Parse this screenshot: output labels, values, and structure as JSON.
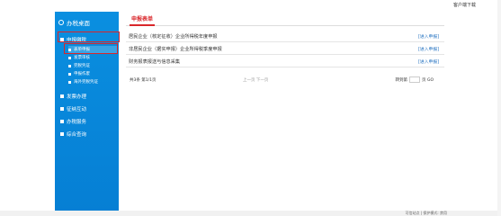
{
  "topbar": {
    "client_download": "客户端下载"
  },
  "sidebar": {
    "home": "办税桌面",
    "sections": [
      {
        "label": "申报缴税"
      },
      {
        "label": "发票办理"
      },
      {
        "label": "征纳互动"
      },
      {
        "label": "办税服务"
      },
      {
        "label": "综合查询"
      }
    ],
    "subitems": [
      {
        "label": "表单申报"
      },
      {
        "label": "发票审核"
      },
      {
        "label": "完税凭证"
      },
      {
        "label": "申报作废"
      },
      {
        "label": "海外完税凭证"
      }
    ]
  },
  "main": {
    "tab_title": "申报表单",
    "rows": [
      {
        "label": "居民企业（核定征收）企业所得税年度申报",
        "action": "[进入申报]"
      },
      {
        "label": "非居民企业（据实申报）企业所得税季度申报",
        "action": "[进入申报]"
      },
      {
        "label": "财务报表报送与信息采集",
        "action": "[进入申报]"
      }
    ],
    "pager": {
      "total": "共3条 第1/1页",
      "nav": "上一页 下一页",
      "goto_label": "转到第",
      "go": "页 GO"
    }
  },
  "bottombar": {
    "text": "可信站点 | 保护模式: 禁用"
  }
}
